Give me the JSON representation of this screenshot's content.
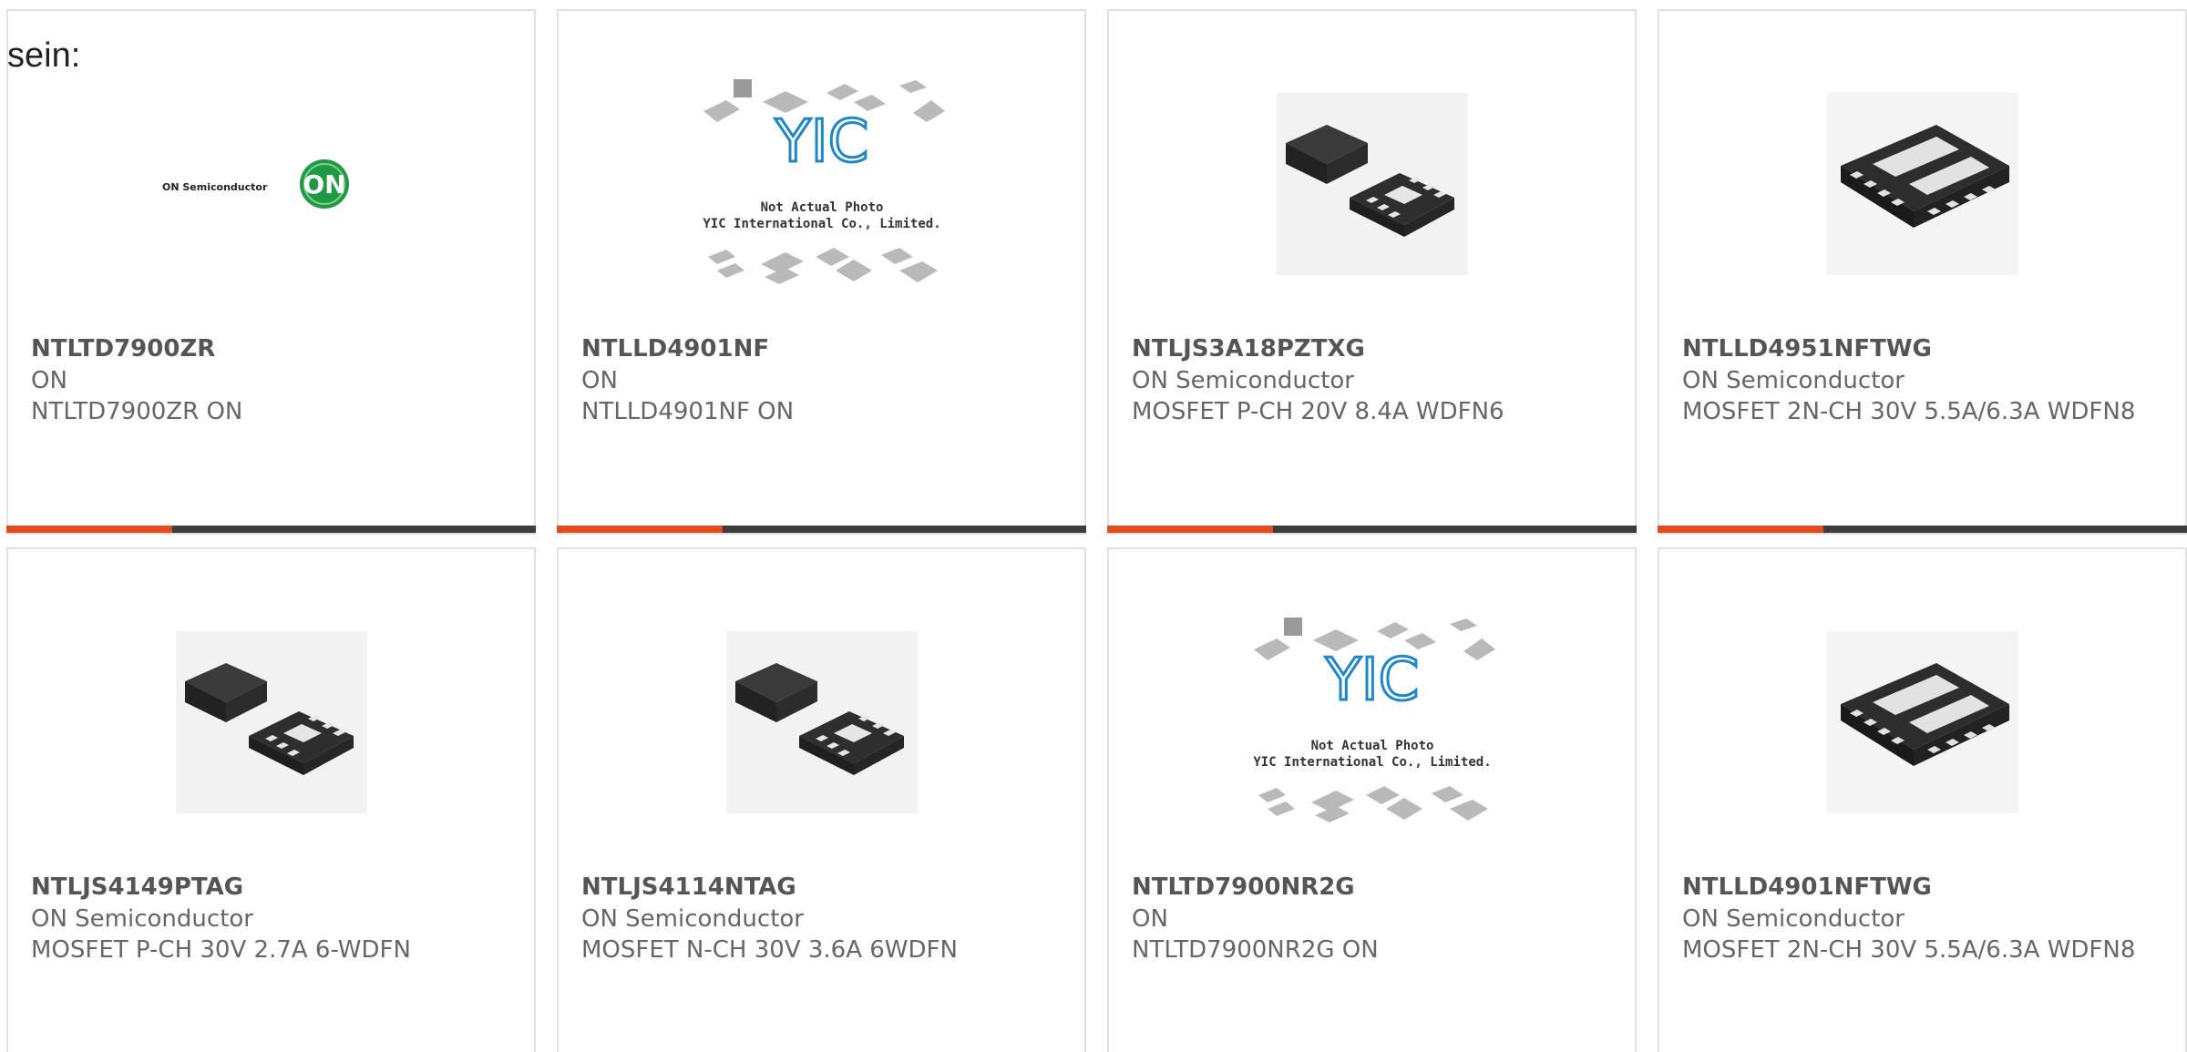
{
  "intro_text": "sein:",
  "products": [
    {
      "part_number": "NTLTD7900ZR",
      "manufacturer": "ON",
      "description": "NTLTD7900ZR ON",
      "image": "on-semiconductor-logo"
    },
    {
      "part_number": "NTLLD4901NF",
      "manufacturer": "ON",
      "description": "NTLLD4901NF ON",
      "image": "yic-placeholder"
    },
    {
      "part_number": "NTLJS3A18PZTXG",
      "manufacturer": "ON Semiconductor",
      "description": "MOSFET P-CH 20V 8.4A WDFN6",
      "image": "wdfn6-chip"
    },
    {
      "part_number": "NTLLD4951NFTWG",
      "manufacturer": "ON Semiconductor",
      "description": "MOSFET 2N-CH 30V 5.5A/6.3A WDFN8",
      "image": "wdfn8-chip"
    },
    {
      "part_number": "NTLJS4149PTAG",
      "manufacturer": "ON Semiconductor",
      "description": "MOSFET P-CH 30V 2.7A 6-WDFN",
      "image": "wdfn6-chip"
    },
    {
      "part_number": "NTLJS4114NTAG",
      "manufacturer": "ON Semiconductor",
      "description": "MOSFET N-CH 30V 3.6A 6WDFN",
      "image": "wdfn6-chip"
    },
    {
      "part_number": "NTLTD7900NR2G",
      "manufacturer": "ON",
      "description": "NTLTD7900NR2G ON",
      "image": "yic-placeholder"
    },
    {
      "part_number": "NTLLD4901NFTWG",
      "manufacturer": "ON Semiconductor",
      "description": "MOSFET 2N-CH 30V 5.5A/6.3A WDFN8",
      "image": "wdfn8-chip"
    }
  ],
  "logo": {
    "brand_text": "ON Semiconductor",
    "mark": "ON"
  },
  "placeholder": {
    "line1": "Not Actual Photo",
    "line2": "YIC International Co., Limited.",
    "mark": "YIC"
  },
  "colors": {
    "accent": "#e8491d",
    "bar": "#3d3d3d",
    "border": "#e1e1e1",
    "logo_green": "#1e9a44",
    "yic_blue": "#1f86c8"
  }
}
